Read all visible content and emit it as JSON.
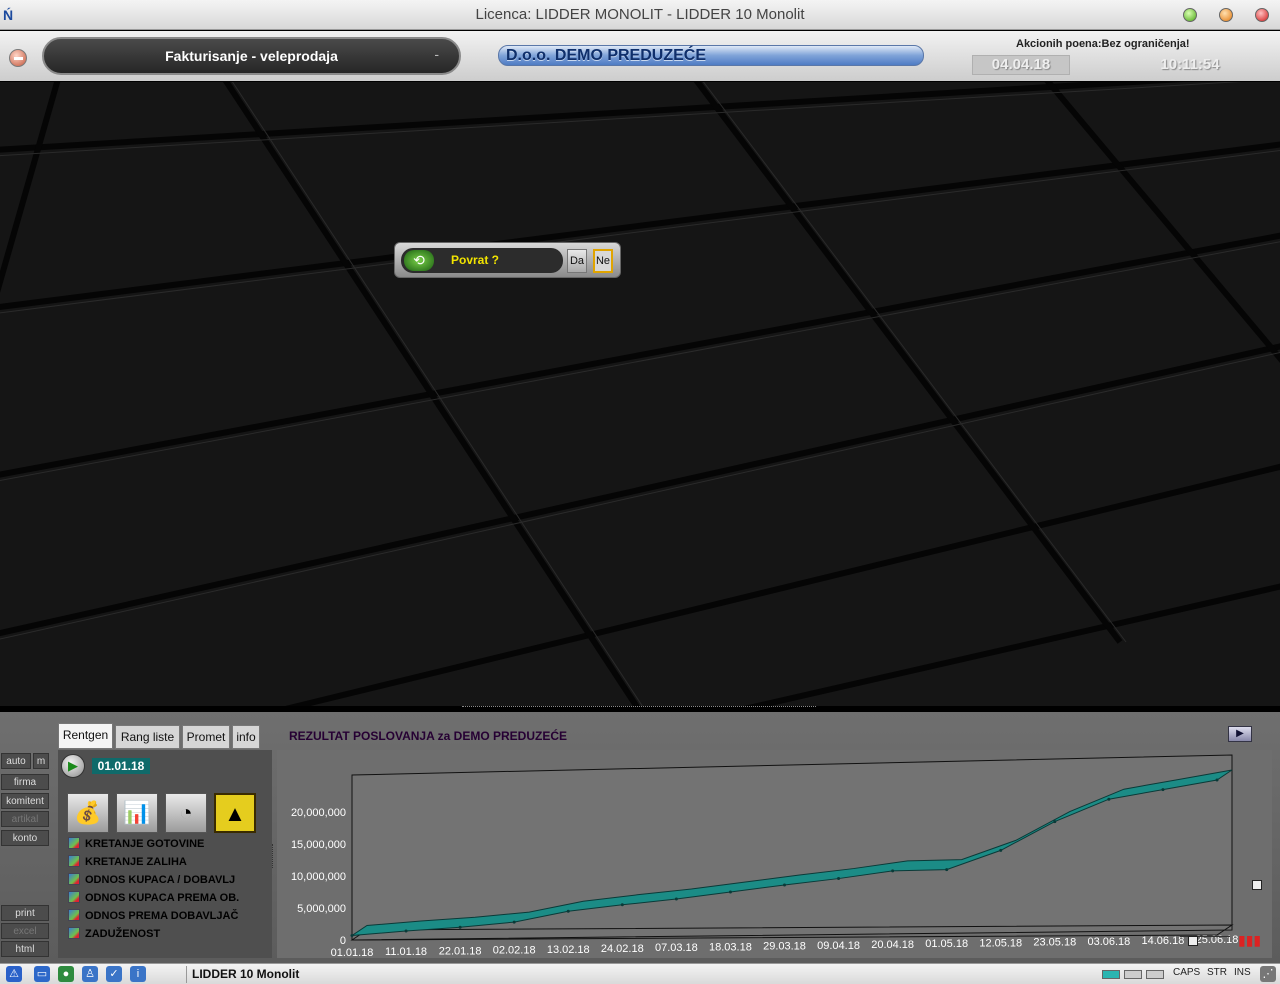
{
  "window": {
    "title": "Licenca: LIDDER MONOLIT - LIDDER 10 Monolit"
  },
  "header": {
    "module": "Fakturisanje - veleprodaja",
    "module_dash": "-",
    "company": "D.o.o. DEMO PREDUZEĆE",
    "promo": "Akcionih poena:Bez ograničenja!",
    "date": "04.04.18",
    "time": "10:11:54"
  },
  "dialog": {
    "question": "Povrat ?",
    "yes": "Da",
    "no": "Ne"
  },
  "side_buttons": {
    "auto": "auto",
    "m": "m",
    "firma": "firma",
    "komitent": "komitent",
    "artikal": "artikal",
    "konto": "konto",
    "print": "print",
    "excel": "excel",
    "html": "html"
  },
  "tabs": [
    "Rentgen",
    "Rang liste",
    "Promet",
    "info"
  ],
  "result_title": "REZULTAT POSLOVANJA za DEMO PREDUZEĆE",
  "start_date": "01.01.18",
  "report_list": [
    "KRETANJE GOTOVINE",
    "KRETANJE ZALIHA",
    "ODNOS KUPACA / DOBAVLJ",
    "ODNOS KUPACA PREMA OB.",
    "ODNOS PREMA DOBAVLJAČ",
    "ZADUŽENOST"
  ],
  "status": {
    "app": "LIDDER 10 Monolit",
    "caps": "CAPS",
    "str": "STR",
    "ins": "INS"
  },
  "chart_data": {
    "type": "area",
    "x": [
      "01.01.18",
      "11.01.18",
      "22.01.18",
      "02.02.18",
      "13.02.18",
      "24.02.18",
      "07.03.18",
      "18.03.18",
      "29.03.18",
      "09.04.18",
      "20.04.18",
      "01.05.18",
      "12.05.18",
      "23.05.18",
      "03.06.18",
      "14.06.18",
      "25.06.18"
    ],
    "series": [
      {
        "values": [
          700000,
          1400000,
          2000000,
          2800000,
          4500000,
          5500000,
          6400000,
          7500000,
          8600000,
          9600000,
          10800000,
          11000000,
          14000000,
          18500000,
          22000000,
          23500000,
          25000000
        ]
      }
    ],
    "ylim": [
      0,
      25000000
    ],
    "yticks": [
      "0",
      "5,000,000",
      "10,000,000",
      "15,000,000",
      "20,000,000"
    ],
    "color": "#1b8c86",
    "grid": false
  }
}
